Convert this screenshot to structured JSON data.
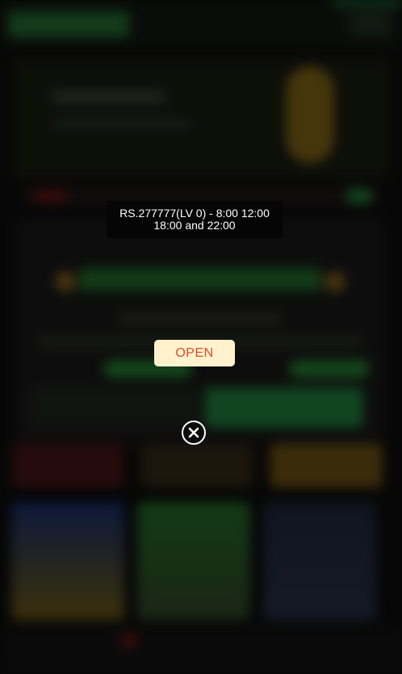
{
  "notice": {
    "line1": "RS.277777(LV 0) - 8:00 12:00",
    "line2": "18:00 and 22:00"
  },
  "open_button": {
    "label": "OPEN"
  },
  "close_button": {
    "icon": "close-icon"
  },
  "colors": {
    "notice_bg": "#050505",
    "open_bg": "#fff2cc",
    "open_text": "#e34a2c",
    "accent_green": "#1d6a2c"
  }
}
